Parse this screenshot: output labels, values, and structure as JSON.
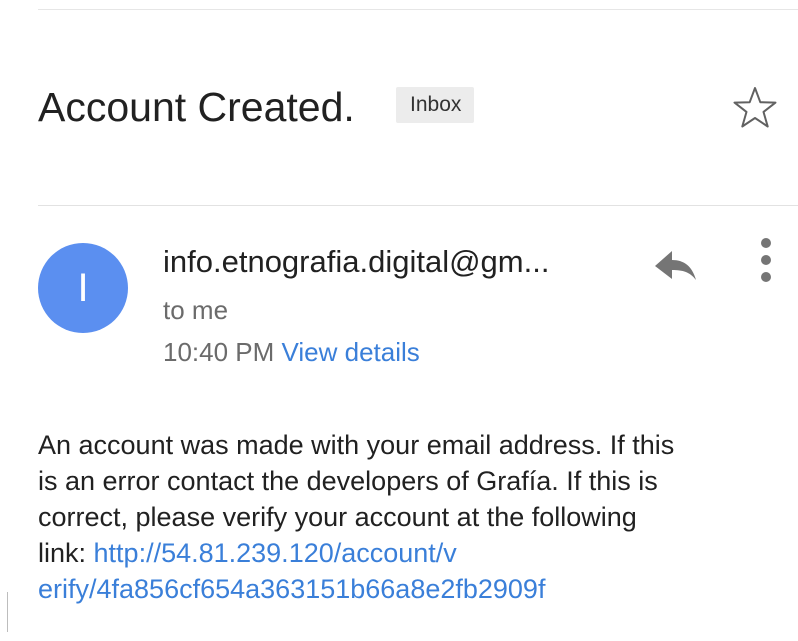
{
  "email": {
    "subject": "Account Created.",
    "label": "Inbox",
    "sender": "info.etnografia.digital@gm...",
    "avatar_initial": "I",
    "recipient": "to me",
    "time": "10:40 PM",
    "view_details": "View details",
    "body": {
      "line1": "An account was made with your email address. If this",
      "line2": "is an error contact the developers of Grafía. If this is",
      "line3": "correct, please verify your account at the following",
      "line4_prefix": "link: ",
      "link_part1": "http://54.81.239.120/account/v",
      "link_part2": "erify/4fa856cf654a363151b66a8e2fb2909f"
    }
  },
  "icons": {
    "star": "star-outline-icon",
    "reply": "reply-icon",
    "more": "more-vertical-icon"
  },
  "colors": {
    "avatar": "#5b8ff0",
    "link": "#3a7fd9",
    "label_chip": "#ececec",
    "icon_gray": "#757575"
  }
}
